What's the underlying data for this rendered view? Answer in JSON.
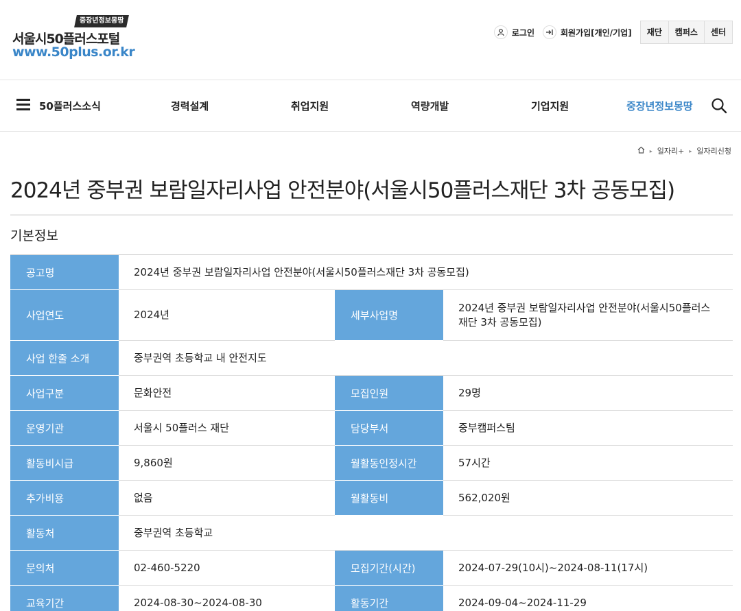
{
  "header": {
    "logo_badge": "중장년정보몽땅",
    "logo_name": "서울시50플러스포털",
    "logo_url": "www.50plus.or.kr",
    "login": "로그인",
    "signup": "회원가입[개인/기업]",
    "util_boxes": [
      "재단",
      "캠퍼스",
      "센터"
    ]
  },
  "nav": {
    "items": [
      "50플러스소식",
      "경력설계",
      "취업지원",
      "역량개발",
      "기업지원",
      "중장년정보몽땅"
    ],
    "active_index": 5,
    "accent_color": "#3a86c8"
  },
  "breadcrumb": [
    "일자리+",
    "일자리신청"
  ],
  "page_title": "2024년 중부권 보람일자리사업 안전분야(서울시50플러스재단 3차 공동모집)",
  "section_title": "기본정보",
  "info": {
    "header_color": "#64a6dc",
    "rows": [
      {
        "l1": "공고명",
        "v1": "2024년 중부권 보람일자리사업 안전분야(서울시50플러스재단 3차 공동모집)"
      },
      {
        "l1": "사업연도",
        "v1": "2024년",
        "l2": "세부사업명",
        "v2": "2024년 중부권 보람일자리사업 안전분야(서울시50플러스재단 3차 공동모집)"
      },
      {
        "l1": "사업 한줄 소개",
        "v1": "중부권역 초등학교 내 안전지도"
      },
      {
        "l1": "사업구분",
        "v1": "문화안전",
        "l2": "모집인원",
        "v2": "29명"
      },
      {
        "l1": "운영기관",
        "v1": "서울시 50플러스 재단",
        "l2": "담당부서",
        "v2": "중부캠퍼스팀"
      },
      {
        "l1": "활동비시급",
        "v1": "9,860원",
        "l2": "월활동인정시간",
        "v2": "57시간"
      },
      {
        "l1": "추가비용",
        "v1": "없음",
        "l2": "월활동비",
        "v2": "562,020원"
      },
      {
        "l1": "활동처",
        "v1": "중부권역 초등학교"
      },
      {
        "l1": "문의처",
        "v1": "02-460-5220",
        "l2": "모집기간(시간)",
        "v2": "2024-07-29(10시)~2024-08-11(17시)"
      },
      {
        "l1": "교육기간",
        "v1": "2024-08-30~2024-08-30",
        "l2": "활동기간",
        "v2": "2024-09-04~2024-11-29"
      }
    ]
  }
}
